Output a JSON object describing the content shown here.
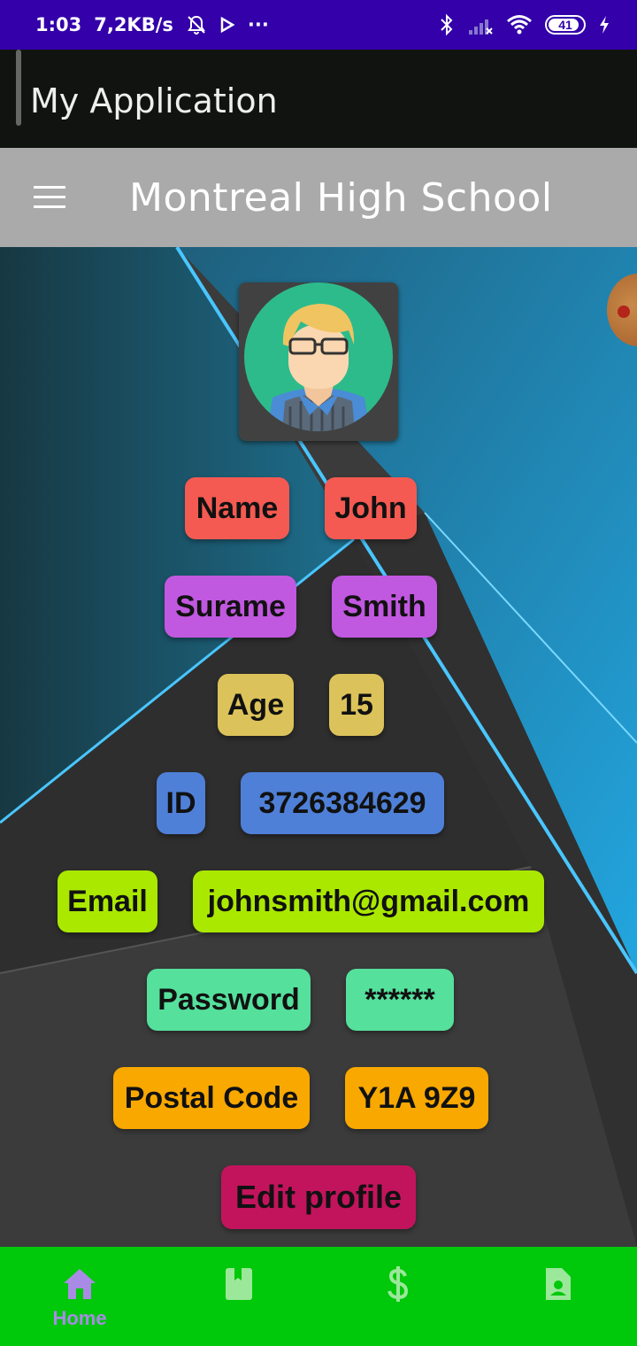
{
  "status_bar": {
    "time": "1:03",
    "speed": "7,2KB/s",
    "more": "···",
    "battery": "41"
  },
  "app_bar": {
    "title": "My Application"
  },
  "toolbar": {
    "title": "Montreal High School"
  },
  "profile": {
    "name_label": "Name",
    "name_value": "John",
    "surname_label": "Surame",
    "surname_value": "Smith",
    "age_label": "Age",
    "age_value": "15",
    "id_label": "ID",
    "id_value": "3726384629",
    "email_label": "Email",
    "email_value": "johnsmith@gmail.com",
    "password_label": "Password",
    "password_value": "******",
    "postal_label": "Postal Code",
    "postal_value": "Y1A 9Z9",
    "edit_button": "Edit profile"
  },
  "colors": {
    "status_bar": "#3300aa",
    "app_bar": "#111311",
    "toolbar": "#aaaaaa",
    "name": "#f45a52",
    "surname": "#c158e0",
    "age": "#dcc25a",
    "id": "#4f80d8",
    "email": "#aae800",
    "password": "#55e09c",
    "postal": "#f9a800",
    "edit": "#c2145c",
    "bottom_nav": "#00c80a",
    "nav_active": "#a98be6",
    "nav_inactive": "#9be89a"
  },
  "bottom_nav": {
    "items": [
      {
        "icon": "home-icon",
        "label": "Home",
        "active": true
      },
      {
        "icon": "book-icon",
        "active": false
      },
      {
        "icon": "dollar-icon",
        "active": false
      },
      {
        "icon": "contact-file-icon",
        "active": false
      }
    ]
  }
}
